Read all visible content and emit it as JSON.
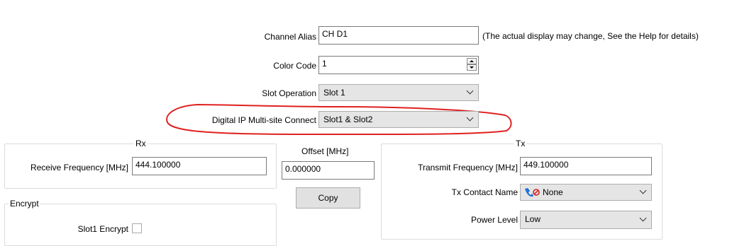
{
  "channel_alias": {
    "label": "Channel Alias",
    "value": "CH D1",
    "note": "(The actual display may change, See the Help for details)"
  },
  "color_code": {
    "label": "Color Code",
    "value": "1"
  },
  "slot_operation": {
    "label": "Slot Operation",
    "value": "Slot 1"
  },
  "digital_ip": {
    "label": "Digital IP Multi-site Connect",
    "value": "Slot1 & Slot2",
    "highlight_color": "#e02020"
  },
  "rx": {
    "title": "Rx",
    "receive_freq_label": "Receive Frequency [MHz]",
    "receive_freq_value": "444.100000"
  },
  "offset": {
    "label": "Offset [MHz]",
    "value": "0.000000",
    "copy_label": "Copy"
  },
  "tx": {
    "title": "Tx",
    "transmit_freq_label": "Transmit Frequency [MHz]",
    "transmit_freq_value": "449.100000",
    "contact_label": "Tx Contact Name",
    "contact_value": "None",
    "contact_icon": "contact-none-icon",
    "power_label": "Power Level",
    "power_value": "Low"
  },
  "encrypt": {
    "title": "Encrypt",
    "slot1_label": "Slot1 Encrypt",
    "slot1_checked": false
  }
}
